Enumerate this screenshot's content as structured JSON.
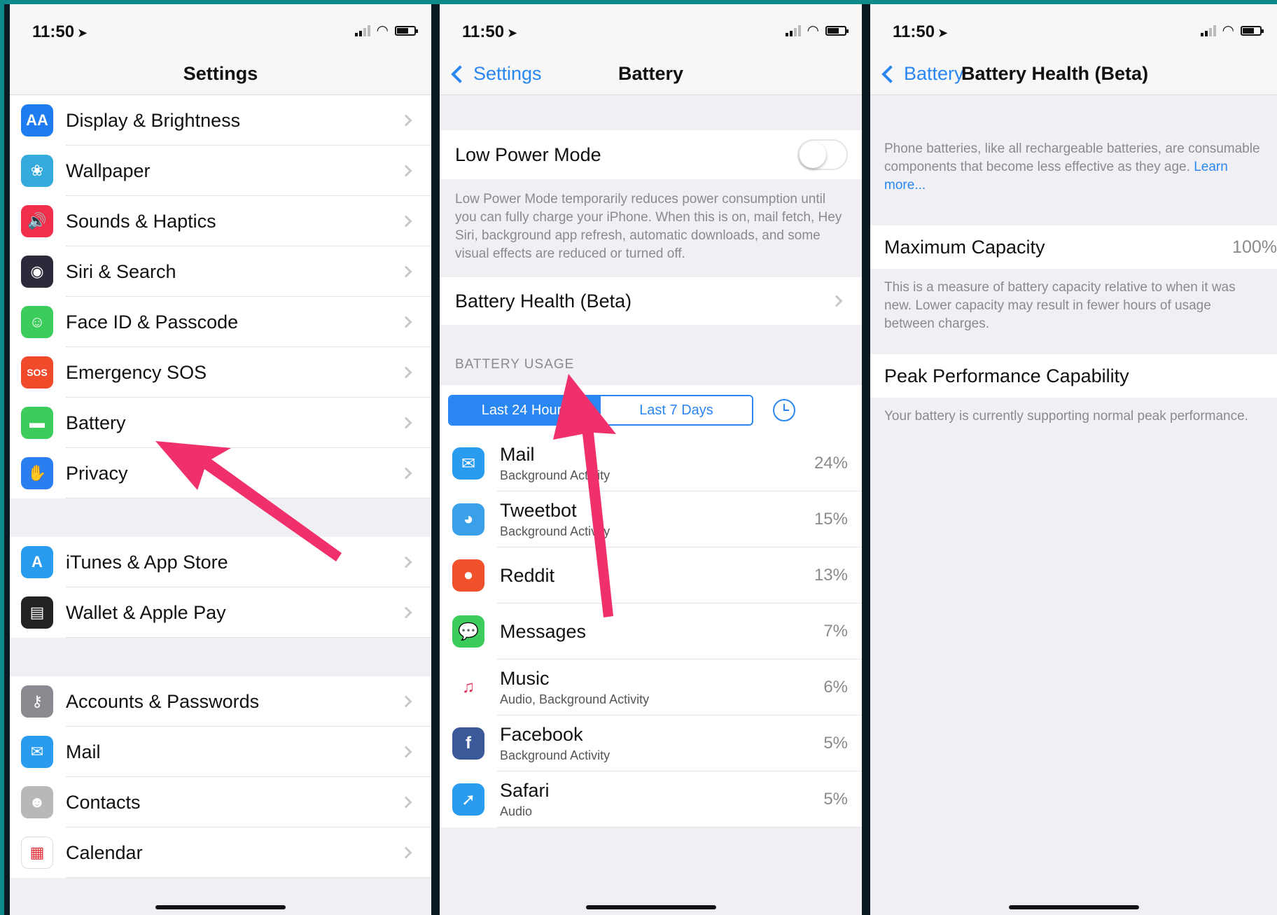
{
  "status_bar": {
    "time": "11:50"
  },
  "settings": {
    "title": "Settings",
    "group1": [
      {
        "label": "Display & Brightness",
        "icon": "display-brightness-icon",
        "color": "#1e7cf0",
        "glyph": "AA"
      },
      {
        "label": "Wallpaper",
        "icon": "wallpaper-icon",
        "color": "#35aadc",
        "glyph": "❀"
      },
      {
        "label": "Sounds & Haptics",
        "icon": "sounds-icon",
        "color": "#f0304a",
        "glyph": "🔊"
      },
      {
        "label": "Siri & Search",
        "icon": "siri-icon",
        "color": "#2a2a3a",
        "glyph": "◉"
      },
      {
        "label": "Face ID & Passcode",
        "icon": "face-id-icon",
        "color": "#3ccc5c",
        "glyph": "☺"
      },
      {
        "label": "Emergency SOS",
        "icon": "sos-icon",
        "color": "#f04a2a",
        "glyph": "SOS"
      },
      {
        "label": "Battery",
        "icon": "battery-icon",
        "color": "#3ccc5c",
        "glyph": "▬"
      },
      {
        "label": "Privacy",
        "icon": "privacy-hand-icon",
        "color": "#2a7ef0",
        "glyph": "✋"
      }
    ],
    "group2": [
      {
        "label": "iTunes & App Store",
        "icon": "app-store-icon",
        "color": "#2a9cf0",
        "glyph": "A"
      },
      {
        "label": "Wallet & Apple Pay",
        "icon": "wallet-icon",
        "color": "#222222",
        "glyph": "▤"
      }
    ],
    "group3": [
      {
        "label": "Accounts & Passwords",
        "icon": "key-icon",
        "color": "#8a8a90",
        "glyph": "⚷"
      },
      {
        "label": "Mail",
        "icon": "mail-icon",
        "color": "#2a9cf0",
        "glyph": "✉"
      },
      {
        "label": "Contacts",
        "icon": "contacts-icon",
        "color": "#b8b8b8",
        "glyph": "☻"
      },
      {
        "label": "Calendar",
        "icon": "calendar-icon",
        "color": "#ffffff",
        "glyph": "▦"
      }
    ]
  },
  "battery": {
    "back": "Settings",
    "title": "Battery",
    "low_power_label": "Low Power Mode",
    "low_power_note": "Low Power Mode temporarily reduces power consumption until you can fully charge your iPhone. When this is on, mail fetch, Hey Siri, background app refresh, automatic downloads, and some visual effects are reduced or turned off.",
    "health_label": "Battery Health (Beta)",
    "usage_header": "BATTERY USAGE",
    "seg_24": "Last 24 Hours",
    "seg_7": "Last 7 Days",
    "apps": [
      {
        "name": "Mail",
        "sub": "Background Activity",
        "pct": "24%",
        "icon": "mail-app-icon",
        "color": "#2a9cf0",
        "glyph": "✉"
      },
      {
        "name": "Tweetbot",
        "sub": "Background Activity",
        "pct": "15%",
        "icon": "tweetbot-icon",
        "color": "#3aa0e8",
        "glyph": "◕"
      },
      {
        "name": "Reddit",
        "sub": "",
        "pct": "13%",
        "icon": "reddit-icon",
        "color": "#f0502a",
        "glyph": "●"
      },
      {
        "name": "Messages",
        "sub": "",
        "pct": "7%",
        "icon": "messages-icon",
        "color": "#3ccc5c",
        "glyph": "💬"
      },
      {
        "name": "Music",
        "sub": "Audio, Background Activity",
        "pct": "6%",
        "icon": "music-icon",
        "color": "#ffffff",
        "glyph": "♫"
      },
      {
        "name": "Facebook",
        "sub": "Background Activity",
        "pct": "5%",
        "icon": "facebook-icon",
        "color": "#3b5998",
        "glyph": "f"
      },
      {
        "name": "Safari",
        "sub": "Audio",
        "pct": "5%",
        "icon": "safari-icon",
        "color": "#2a9cf0",
        "glyph": "➚"
      }
    ]
  },
  "health": {
    "back": "Battery",
    "title": "Battery Health (Beta)",
    "intro": "Phone batteries, like all rechargeable batteries, are consumable components that become less effective as they age.",
    "learn_more": "Learn more...",
    "max_label": "Maximum Capacity",
    "max_value": "100%",
    "max_note": "This is a measure of battery capacity relative to when it was new. Lower capacity may result in fewer hours of usage between charges.",
    "peak_label": "Peak Performance Capability",
    "peak_note": "Your battery is currently supporting normal peak performance."
  },
  "colors": {
    "accent": "#2a86f0",
    "arrow": "#f0306a",
    "frame": "#0f8a8a"
  }
}
